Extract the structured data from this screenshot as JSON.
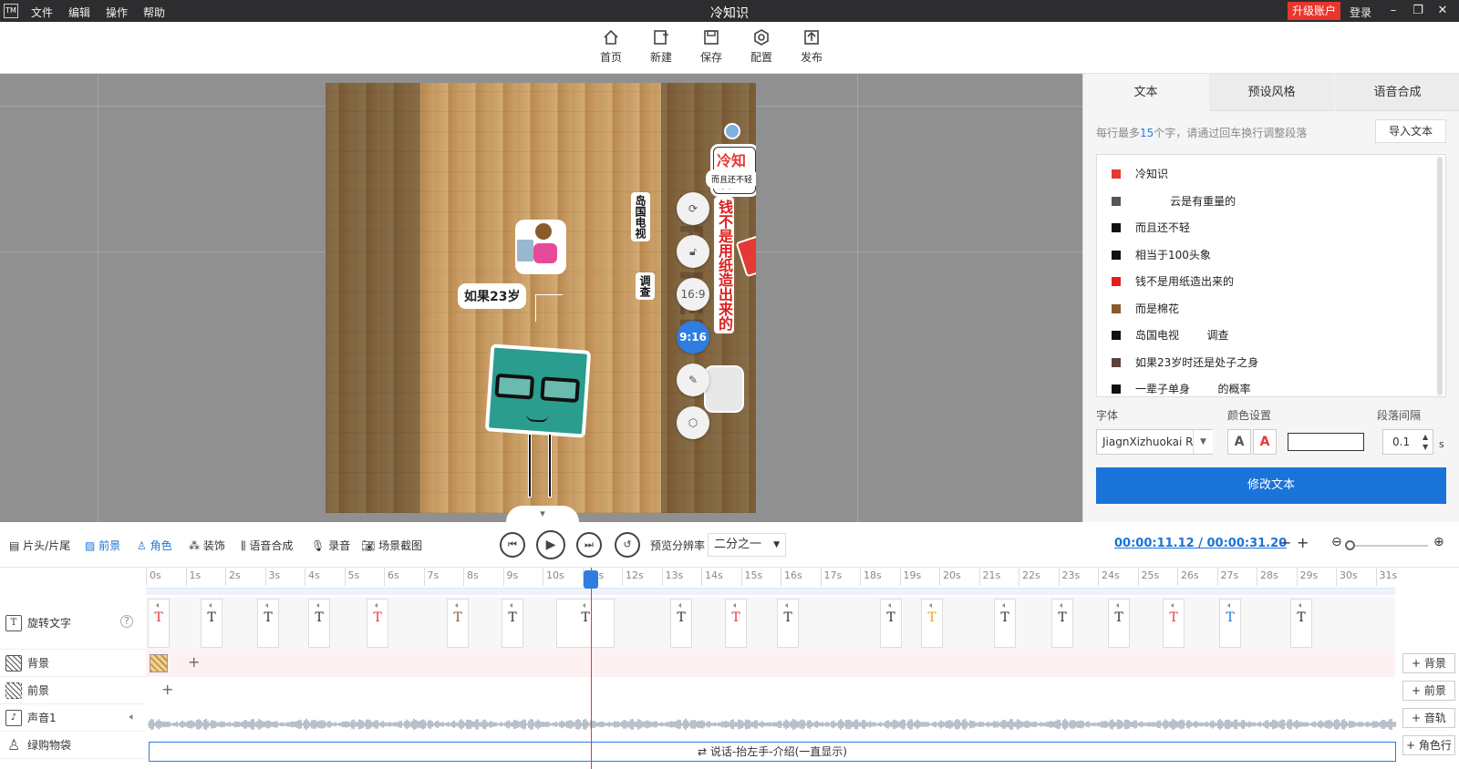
{
  "app": {
    "logo": "TM",
    "title": "冷知识",
    "menu": [
      "文件",
      "编辑",
      "操作",
      "帮助"
    ],
    "upgrade": "升级账户",
    "login": "登录"
  },
  "toolbar": [
    {
      "label": "首页",
      "icon": "home-icon"
    },
    {
      "label": "新建",
      "icon": "new-icon"
    },
    {
      "label": "保存",
      "icon": "save-icon"
    },
    {
      "label": "配置",
      "icon": "settings-icon"
    },
    {
      "label": "发布",
      "icon": "publish-icon"
    }
  ],
  "stage": {
    "texts": {
      "title": "冷知识",
      "small": "而且还不轻",
      "vertical_red": "钱不是用纸造出来的",
      "vertical_black": "岛国电视",
      "survey": "调查",
      "age": "如果23岁"
    },
    "float_buttons": [
      "16:9",
      "9:16"
    ],
    "active_ratio": "9:16"
  },
  "panel": {
    "tabs": [
      "文本",
      "预设风格",
      "语音合成"
    ],
    "active_tab": "文本",
    "hint_prefix": "每行最多",
    "hint_num": "15",
    "hint_suffix": "个字，请通过回车换行调整段落",
    "import_label": "导入文本",
    "rows": [
      {
        "text": "冷知识",
        "color": "#e53935"
      },
      {
        "text": "          云是有重量的",
        "color": "#555555"
      },
      {
        "text": "而且还不轻",
        "color": "#111111"
      },
      {
        "text": "相当于100头象",
        "color": "#111111"
      },
      {
        "text": "钱不是用纸造出来的",
        "color": "#e02020"
      },
      {
        "text": "而是棉花",
        "color": "#8b5a2b"
      },
      {
        "text": "岛国电视        调查",
        "color": "#111111"
      },
      {
        "text": "如果23岁时还是处子之身",
        "color": "#5d4037"
      },
      {
        "text": "一辈子单身        的概率",
        "color": "#111111"
      }
    ],
    "font_label": "字体",
    "font_value": "JiagnXizhuokai R",
    "color_label": "颜色设置",
    "spacing_label": "段落间隔",
    "spacing_value": "0.1",
    "spacing_unit": "s",
    "modify_label": "修改文本"
  },
  "bottom_toolbar": {
    "items": [
      "片头/片尾",
      "前景",
      "角色",
      "装饰",
      "语音合成",
      "录音",
      "场景截图"
    ],
    "active": "前景",
    "resolution_label": "预览分辨率",
    "resolution_value": "二分之一",
    "time_current": "00:00:11.12",
    "time_sep": "/",
    "time_total": "00:00:31.20"
  },
  "ruler": [
    "0s",
    "1s",
    "2s",
    "3s",
    "4s",
    "5s",
    "6s",
    "7s",
    "8s",
    "9s",
    "10s",
    "11s",
    "12s",
    "13s",
    "14s",
    "15s",
    "16s",
    "17s",
    "18s",
    "19s",
    "20s",
    "21s",
    "22s",
    "23s",
    "24s",
    "25s",
    "26s",
    "27s",
    "28s",
    "29s",
    "30s",
    "31s"
  ],
  "tracks": [
    {
      "name": "旋转文字",
      "icon": "text-track-icon"
    },
    {
      "name": "背景",
      "icon": "background-track-icon",
      "add": "背景"
    },
    {
      "name": "前景",
      "icon": "foreground-track-icon",
      "add": "前景"
    },
    {
      "name": "声音1",
      "icon": "music-track-icon",
      "add": "音轨"
    },
    {
      "name": "绿购物袋",
      "icon": "character-track-icon",
      "add": "角色行"
    }
  ],
  "text_clip_colors": [
    "#e53935",
    "#333333",
    "#333333",
    "#333333",
    "#e53935",
    "#8b5a2b",
    "#333333",
    "#333333",
    "#333333",
    "#e53935",
    "#333333",
    "#333333",
    "#f0a020",
    "#333333",
    "#333333",
    "#333333",
    "#e53935",
    "#1a73d9",
    "#333333"
  ],
  "dialog_clip": "说话-抬左手-介绍(一直显示)"
}
